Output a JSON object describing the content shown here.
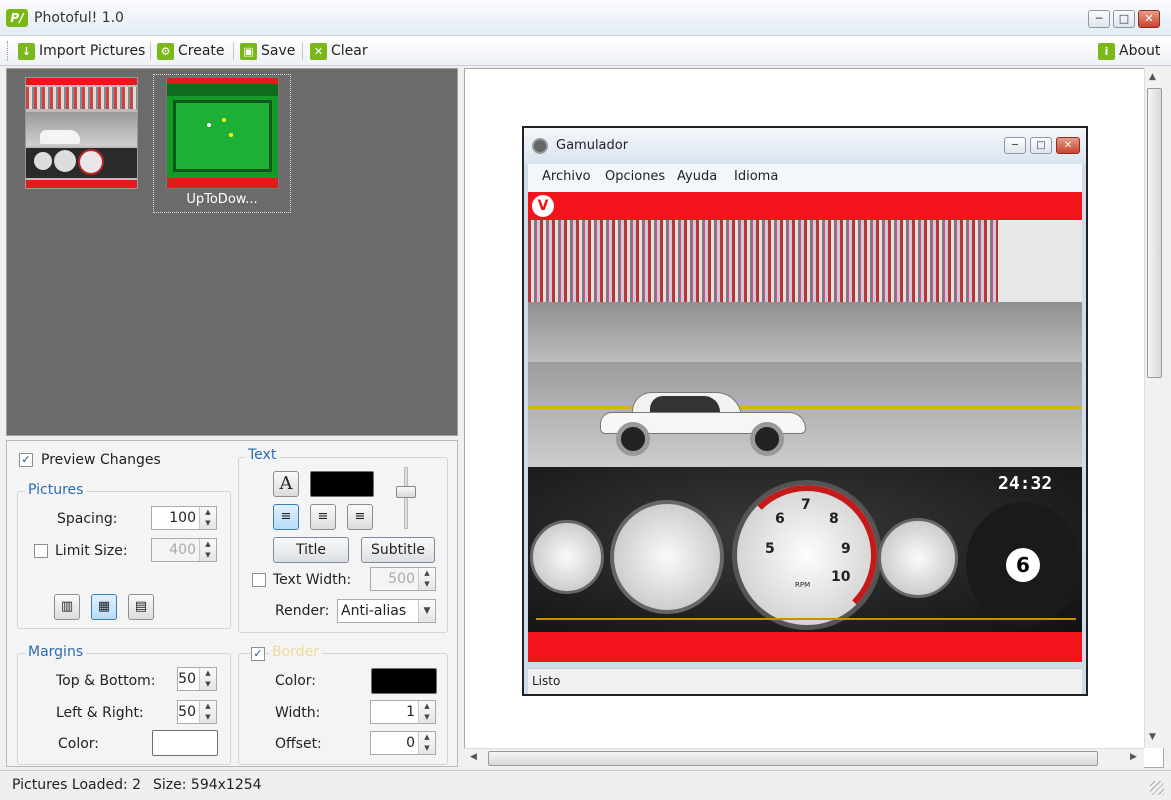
{
  "window": {
    "title": "Photoful! 1.0",
    "logo": "P/"
  },
  "toolbar": {
    "import": "Import Pictures",
    "create": "Create",
    "save": "Save",
    "clear": "Clear",
    "about": "About"
  },
  "thumbnails": [
    {
      "label": ""
    },
    {
      "label": "UpToDow..."
    }
  ],
  "controls": {
    "preview_changes": "Preview Changes",
    "pictures": {
      "group": "Pictures",
      "spacing_label": "Spacing:",
      "spacing_value": "100",
      "limit_size_label": "Limit Size:",
      "limit_size_value": "400"
    },
    "text": {
      "group": "Text",
      "font_glyph": "A",
      "title_button": "Title",
      "subtitle_button": "Subtitle",
      "text_width_label": "Text Width:",
      "text_width_value": "500",
      "render_label": "Render:",
      "render_value": "Anti-alias"
    },
    "margins": {
      "group": "Margins",
      "top_bottom_label": "Top & Bottom:",
      "top_bottom_value": "50",
      "left_right_label": "Left & Right:",
      "left_right_value": "50",
      "color_label": "Color:"
    },
    "border": {
      "group": "Border",
      "color_label": "Color:",
      "width_label": "Width:",
      "width_value": "1",
      "offset_label": "Offset:",
      "offset_value": "0"
    }
  },
  "preview": {
    "app_title": "Gamulador",
    "menu": [
      "Archivo",
      "Opciones",
      "Ayuda",
      "Idioma"
    ],
    "timer": "24:32",
    "gear": "6",
    "status": "Listo",
    "gauge_numbers": [
      "5",
      "6",
      "7",
      "8",
      "9",
      "10"
    ],
    "rpm_label": "RPM"
  },
  "status": {
    "pictures_loaded": "Pictures Loaded: 2",
    "size": "Size: 594x1254"
  },
  "colors": {
    "text_color": "#000000",
    "margin_color": "#ffffff",
    "border_color": "#000000",
    "accent_green": "#79b818"
  }
}
